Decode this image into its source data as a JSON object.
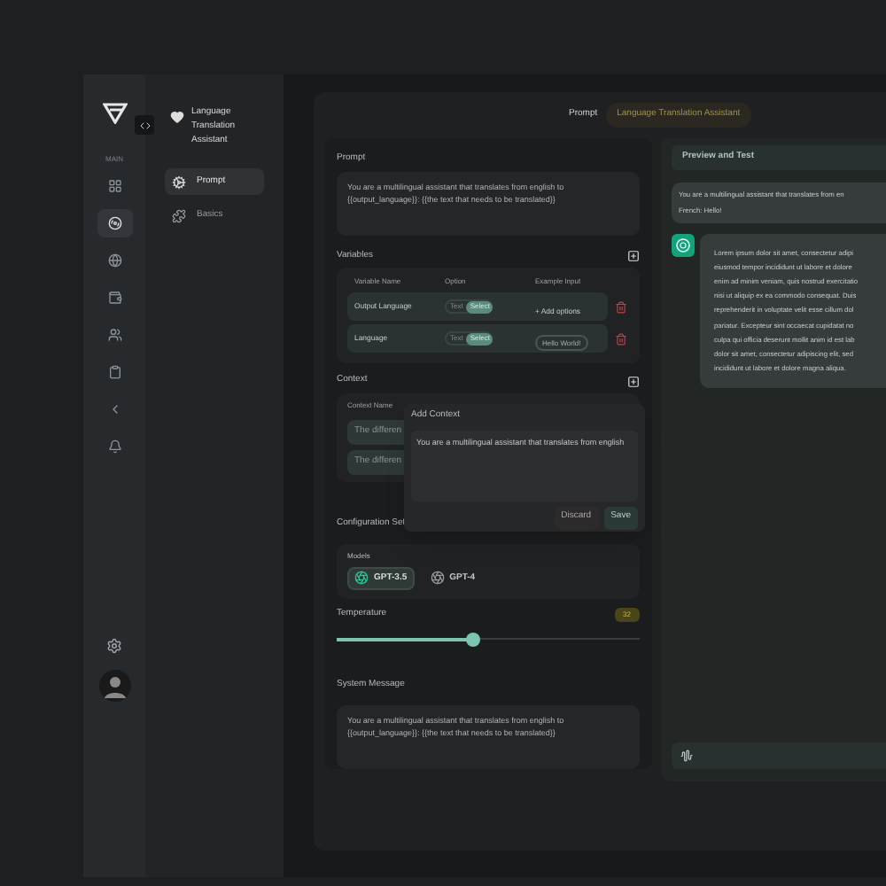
{
  "rail": {
    "section_label": "MAIN",
    "items": [
      {
        "selected": false
      },
      {
        "selected": true
      },
      {
        "selected": false
      },
      {
        "selected": false
      },
      {
        "selected": false
      },
      {
        "selected": false
      },
      {
        "selected": false
      },
      {
        "selected": false
      }
    ]
  },
  "sidebar": {
    "title": "Language Translation Assistant",
    "items": [
      {
        "label": "Prompt",
        "selected": true
      },
      {
        "label": "Basics",
        "selected": false
      }
    ]
  },
  "header": {
    "label": "Prompt",
    "badge": "Language Translation Assistant"
  },
  "prompt": {
    "label": "Prompt",
    "value": "You are a multilingual assistant that translates from english to {{output_language}}: {{the text that needs to be translated}}"
  },
  "variables": {
    "label": "Variables",
    "columns": [
      "Variable Name",
      "Option",
      "Example Input"
    ],
    "rows": [
      {
        "name": "Output Language",
        "options": [
          {
            "label": "Text",
            "selected": false
          },
          {
            "label": "Select",
            "selected": true
          }
        ],
        "example": {
          "kind": "link",
          "text": "+ Add options"
        }
      },
      {
        "name": "Language",
        "options": [
          {
            "label": "Text",
            "selected": false
          },
          {
            "label": "Select",
            "selected": true
          }
        ],
        "example": {
          "kind": "chip",
          "text": "Hello World!"
        }
      }
    ]
  },
  "context": {
    "label": "Context",
    "column": "Context Name",
    "rows": [
      "The differen",
      "The differen"
    ]
  },
  "add_context": {
    "title": "Add Context",
    "value": "You are a multilingual assistant that translates from english",
    "buttons": [
      {
        "label": "Discard",
        "kind": "secondary"
      },
      {
        "label": "Save",
        "kind": "primary"
      }
    ]
  },
  "configuration": {
    "label": "Configuration Set",
    "models_label": "Models",
    "models": [
      {
        "label": "GPT-3.5",
        "selected": true
      },
      {
        "label": "GPT-4",
        "selected": false
      }
    ]
  },
  "temperature": {
    "label": "Temperature",
    "reading": "32",
    "level": 0.45
  },
  "system_message": {
    "label": "System Message",
    "value": "You are a multilingual assistant that translates from english to {{output_language}}: {{the text that needs to be translated}}"
  },
  "preview": {
    "title": "Preview and Test",
    "messages": [
      {
        "kind": "user",
        "lines": [
          "You are a multilingual assistant that translates from en",
          "French: Hello!"
        ]
      },
      {
        "kind": "assistant",
        "lines": [
          "Lorem ipsum dolor sit amet, consectetur adipi",
          "eiusmod tempor incididunt ut labore et dolore",
          "enim ad minim veniam, quis nostrud exercitatio",
          "nisi ut aliquip ex ea commodo consequat. Duis",
          "reprehenderit in voluptate velit esse cillum dol",
          "pariatur. Excepteur sint occaecat cupidatat no",
          "culpa qui officia deserunt mollit anim id est lab",
          "dolor sit amet, consectetur adipiscing elit, sed",
          "incididunt ut labore et dolore magna aliqua."
        ]
      }
    ]
  }
}
